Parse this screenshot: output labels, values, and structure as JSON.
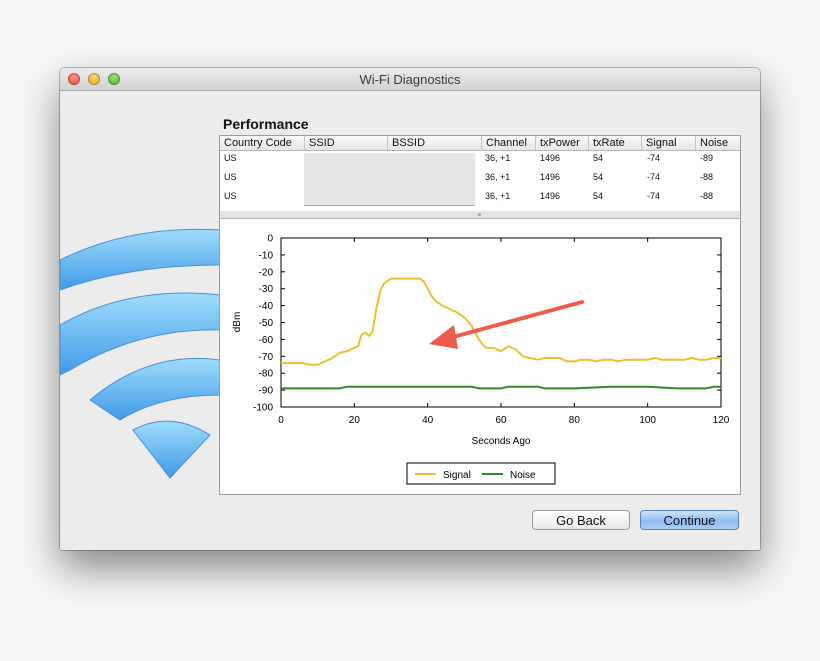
{
  "window": {
    "title": "Wi-Fi Diagnostics"
  },
  "performance": {
    "heading": "Performance",
    "columns": [
      "Country Code",
      "SSID",
      "BSSID",
      "Channel",
      "txPower",
      "txRate",
      "Signal",
      "Noise"
    ],
    "rows": [
      {
        "country": "US",
        "channel": "36, +1",
        "txpower": "1496",
        "txrate": "54",
        "signal": "-74",
        "noise": "-89"
      },
      {
        "country": "US",
        "channel": "36, +1",
        "txpower": "1496",
        "txrate": "54",
        "signal": "-74",
        "noise": "-88"
      },
      {
        "country": "US",
        "channel": "36, +1",
        "txpower": "1496",
        "txrate": "54",
        "signal": "-74",
        "noise": "-88"
      }
    ]
  },
  "buttons": {
    "back": "Go Back",
    "continue": "Continue"
  },
  "colors": {
    "signal": "#ecc02f",
    "noise": "#2f8a2f",
    "arrow": "#ef5b4b",
    "accent": "#8fbdf0"
  },
  "icons": {
    "wifi": "wifi-icon"
  },
  "chart_data": {
    "type": "line",
    "xlabel": "Seconds Ago",
    "ylabel": "dBm",
    "xlim": [
      0,
      120
    ],
    "ylim": [
      -100,
      0
    ],
    "xticks": [
      0,
      20,
      40,
      60,
      80,
      100,
      120
    ],
    "yticks": [
      0,
      -10,
      -20,
      -30,
      -40,
      -50,
      -60,
      -70,
      -80,
      -90,
      -100
    ],
    "legend": "bottom-center",
    "series": [
      {
        "name": "Signal",
        "x": [
          0,
          6,
          8,
          10,
          12,
          14,
          16,
          18,
          20,
          21,
          22,
          23,
          24,
          25,
          26,
          27,
          28,
          30,
          32,
          34,
          36,
          38,
          39,
          40,
          41,
          42,
          44,
          46,
          48,
          50,
          52,
          54,
          55,
          56,
          58,
          60,
          62,
          64,
          66,
          68,
          70,
          72,
          74,
          76,
          78,
          80,
          82,
          84,
          86,
          88,
          90,
          92,
          94,
          96,
          98,
          100,
          102,
          104,
          106,
          108,
          110,
          112,
          114,
          116,
          118,
          120
        ],
        "y": [
          -74,
          -74,
          -75,
          -75,
          -73,
          -71,
          -68,
          -67,
          -65,
          -64,
          -57,
          -56,
          -58,
          -55,
          -42,
          -32,
          -27,
          -24,
          -24,
          -24,
          -24,
          -24,
          -26,
          -30,
          -34,
          -37,
          -40,
          -42,
          -44,
          -47,
          -52,
          -60,
          -63,
          -65,
          -65,
          -67,
          -64,
          -66,
          -70,
          -71,
          -72,
          -71,
          -71,
          -71,
          -73,
          -73,
          -72,
          -72,
          -73,
          -72,
          -72,
          -73,
          -72,
          -72,
          -72,
          -72,
          -71,
          -72,
          -72,
          -72,
          -72,
          -71,
          -72,
          -72,
          -71,
          -71
        ]
      },
      {
        "name": "Noise",
        "x": [
          0,
          8,
          10,
          16,
          18,
          30,
          40,
          50,
          52,
          54,
          60,
          62,
          64,
          70,
          72,
          80,
          90,
          92,
          100,
          108,
          110,
          116,
          118,
          120
        ],
        "y": [
          -89,
          -89,
          -89,
          -89,
          -88,
          -88,
          -88,
          -88,
          -88,
          -89,
          -89,
          -88,
          -88,
          -88,
          -89,
          -89,
          -88,
          -88,
          -88,
          -89,
          -89,
          -89,
          -88,
          -88
        ]
      }
    ]
  }
}
